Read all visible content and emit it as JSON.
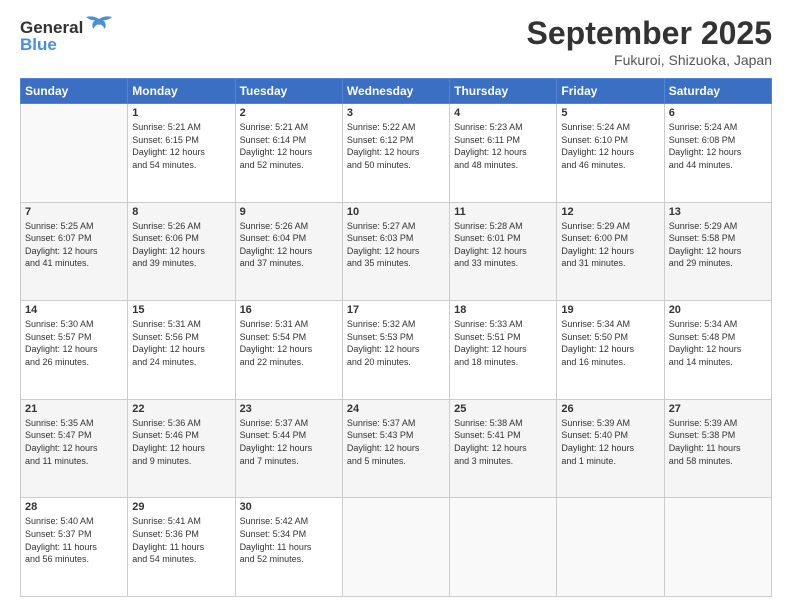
{
  "header": {
    "logo_general": "General",
    "logo_blue": "Blue",
    "month": "September 2025",
    "location": "Fukuroi, Shizuoka, Japan"
  },
  "weekdays": [
    "Sunday",
    "Monday",
    "Tuesday",
    "Wednesday",
    "Thursday",
    "Friday",
    "Saturday"
  ],
  "weeks": [
    [
      {
        "num": "",
        "info": ""
      },
      {
        "num": "1",
        "info": "Sunrise: 5:21 AM\nSunset: 6:15 PM\nDaylight: 12 hours\nand 54 minutes."
      },
      {
        "num": "2",
        "info": "Sunrise: 5:21 AM\nSunset: 6:14 PM\nDaylight: 12 hours\nand 52 minutes."
      },
      {
        "num": "3",
        "info": "Sunrise: 5:22 AM\nSunset: 6:12 PM\nDaylight: 12 hours\nand 50 minutes."
      },
      {
        "num": "4",
        "info": "Sunrise: 5:23 AM\nSunset: 6:11 PM\nDaylight: 12 hours\nand 48 minutes."
      },
      {
        "num": "5",
        "info": "Sunrise: 5:24 AM\nSunset: 6:10 PM\nDaylight: 12 hours\nand 46 minutes."
      },
      {
        "num": "6",
        "info": "Sunrise: 5:24 AM\nSunset: 6:08 PM\nDaylight: 12 hours\nand 44 minutes."
      }
    ],
    [
      {
        "num": "7",
        "info": "Sunrise: 5:25 AM\nSunset: 6:07 PM\nDaylight: 12 hours\nand 41 minutes."
      },
      {
        "num": "8",
        "info": "Sunrise: 5:26 AM\nSunset: 6:06 PM\nDaylight: 12 hours\nand 39 minutes."
      },
      {
        "num": "9",
        "info": "Sunrise: 5:26 AM\nSunset: 6:04 PM\nDaylight: 12 hours\nand 37 minutes."
      },
      {
        "num": "10",
        "info": "Sunrise: 5:27 AM\nSunset: 6:03 PM\nDaylight: 12 hours\nand 35 minutes."
      },
      {
        "num": "11",
        "info": "Sunrise: 5:28 AM\nSunset: 6:01 PM\nDaylight: 12 hours\nand 33 minutes."
      },
      {
        "num": "12",
        "info": "Sunrise: 5:29 AM\nSunset: 6:00 PM\nDaylight: 12 hours\nand 31 minutes."
      },
      {
        "num": "13",
        "info": "Sunrise: 5:29 AM\nSunset: 5:58 PM\nDaylight: 12 hours\nand 29 minutes."
      }
    ],
    [
      {
        "num": "14",
        "info": "Sunrise: 5:30 AM\nSunset: 5:57 PM\nDaylight: 12 hours\nand 26 minutes."
      },
      {
        "num": "15",
        "info": "Sunrise: 5:31 AM\nSunset: 5:56 PM\nDaylight: 12 hours\nand 24 minutes."
      },
      {
        "num": "16",
        "info": "Sunrise: 5:31 AM\nSunset: 5:54 PM\nDaylight: 12 hours\nand 22 minutes."
      },
      {
        "num": "17",
        "info": "Sunrise: 5:32 AM\nSunset: 5:53 PM\nDaylight: 12 hours\nand 20 minutes."
      },
      {
        "num": "18",
        "info": "Sunrise: 5:33 AM\nSunset: 5:51 PM\nDaylight: 12 hours\nand 18 minutes."
      },
      {
        "num": "19",
        "info": "Sunrise: 5:34 AM\nSunset: 5:50 PM\nDaylight: 12 hours\nand 16 minutes."
      },
      {
        "num": "20",
        "info": "Sunrise: 5:34 AM\nSunset: 5:48 PM\nDaylight: 12 hours\nand 14 minutes."
      }
    ],
    [
      {
        "num": "21",
        "info": "Sunrise: 5:35 AM\nSunset: 5:47 PM\nDaylight: 12 hours\nand 11 minutes."
      },
      {
        "num": "22",
        "info": "Sunrise: 5:36 AM\nSunset: 5:46 PM\nDaylight: 12 hours\nand 9 minutes."
      },
      {
        "num": "23",
        "info": "Sunrise: 5:37 AM\nSunset: 5:44 PM\nDaylight: 12 hours\nand 7 minutes."
      },
      {
        "num": "24",
        "info": "Sunrise: 5:37 AM\nSunset: 5:43 PM\nDaylight: 12 hours\nand 5 minutes."
      },
      {
        "num": "25",
        "info": "Sunrise: 5:38 AM\nSunset: 5:41 PM\nDaylight: 12 hours\nand 3 minutes."
      },
      {
        "num": "26",
        "info": "Sunrise: 5:39 AM\nSunset: 5:40 PM\nDaylight: 12 hours\nand 1 minute."
      },
      {
        "num": "27",
        "info": "Sunrise: 5:39 AM\nSunset: 5:38 PM\nDaylight: 11 hours\nand 58 minutes."
      }
    ],
    [
      {
        "num": "28",
        "info": "Sunrise: 5:40 AM\nSunset: 5:37 PM\nDaylight: 11 hours\nand 56 minutes."
      },
      {
        "num": "29",
        "info": "Sunrise: 5:41 AM\nSunset: 5:36 PM\nDaylight: 11 hours\nand 54 minutes."
      },
      {
        "num": "30",
        "info": "Sunrise: 5:42 AM\nSunset: 5:34 PM\nDaylight: 11 hours\nand 52 minutes."
      },
      {
        "num": "",
        "info": ""
      },
      {
        "num": "",
        "info": ""
      },
      {
        "num": "",
        "info": ""
      },
      {
        "num": "",
        "info": ""
      }
    ]
  ]
}
